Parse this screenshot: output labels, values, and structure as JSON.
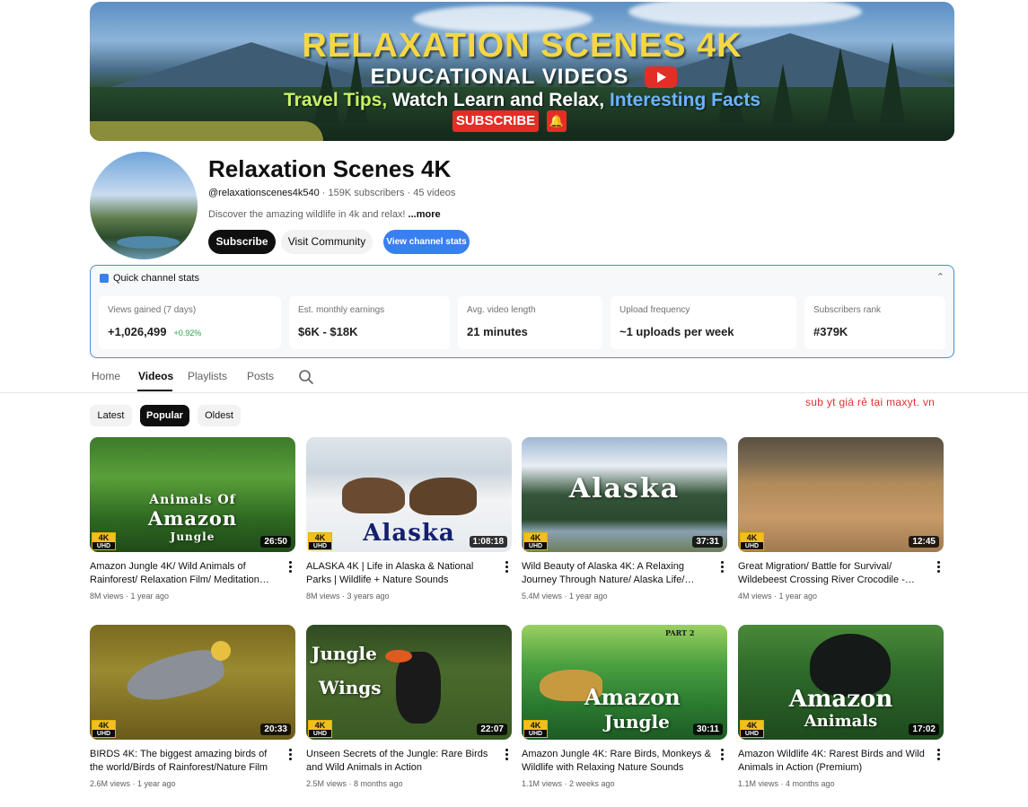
{
  "banner": {
    "title": "RELAXATION SCENES 4K",
    "subtitle": "EDUCATIONAL VIDEOS",
    "tagline_1": "Travel Tips, ",
    "tagline_2": "Watch Learn and Relax, ",
    "tagline_3": "Interesting Facts",
    "subscribe_label": "SUBSCRIBE"
  },
  "channel": {
    "name": "Relaxation Scenes 4K",
    "handle": "@relaxationscenes4k540",
    "stats_text": " · 159K subscribers · 45 videos",
    "description": "Discover the amazing wildlife in 4k and relax! ",
    "more_label": "...more"
  },
  "actions": {
    "subscribe": "Subscribe",
    "community": "Visit Community",
    "stats": "View channel stats"
  },
  "quick_stats": {
    "title": "Quick channel stats",
    "items": [
      {
        "label": "Views gained (7 days)",
        "value": "+1,026,499",
        "change": "+0.92%"
      },
      {
        "label": "Est. monthly earnings",
        "value": "$6K - $18K"
      },
      {
        "label": "Avg. video length",
        "value": "21 minutes"
      },
      {
        "label": "Upload frequency",
        "value": "~1 uploads per week"
      },
      {
        "label": "Subscribers rank",
        "value": "#379K"
      }
    ]
  },
  "tabs": [
    "Home",
    "Videos",
    "Playlists",
    "Posts"
  ],
  "active_tab": "Videos",
  "promo_text": "sub yt giá rẻ tại maxyt. vn",
  "filters": [
    "Latest",
    "Popular",
    "Oldest"
  ],
  "active_filter": "Popular",
  "badge": {
    "top": "4K",
    "bottom": "UHD"
  },
  "videos": [
    {
      "title": "Amazon Jungle 4K/ Wild Animals of Rainforest/ Relaxation Film/ Meditation…",
      "views": "8M views",
      "age": "1 year ago",
      "duration": "26:50",
      "thumb_text_1": "Animals Of",
      "thumb_text_2": "Amazon",
      "thumb_text_3": "Jungle"
    },
    {
      "title": "ALASKA 4K | Life in Alaska & National Parks | Wildlife + Nature Sounds",
      "views": "8M views",
      "age": "3 years ago",
      "duration": "1:08:18",
      "thumb_text_1": "Alaska"
    },
    {
      "title": "Wild Beauty of Alaska 4K: A Relaxing Journey Through Nature/ Alaska Life/…",
      "views": "5.4M views",
      "age": "1 year ago",
      "duration": "37:31",
      "thumb_text_1": "Alaska"
    },
    {
      "title": "Great Migration/ Battle for Survival/ Wildebeest Crossing River Crocodile -…",
      "views": "4M views",
      "age": "1 year ago",
      "duration": "12:45"
    },
    {
      "title": "BIRDS 4K: The biggest amazing birds of the world/Birds of Rainforest/Nature Film &…",
      "views": "2.6M views",
      "age": "1 year ago",
      "duration": "20:33"
    },
    {
      "title": "Unseen Secrets of the Jungle: Rare Birds and Wild Animals in Action",
      "views": "2.5M views",
      "age": "8 months ago",
      "duration": "22:07",
      "thumb_text_1": "Jungle",
      "thumb_text_2": "Wings"
    },
    {
      "title": "Amazon Jungle 4K: Rare Birds, Monkeys & Wildlife with Relaxing Nature Sounds",
      "views": "1.1M views",
      "age": "2 weeks ago",
      "duration": "30:11",
      "thumb_text_1": "Amazon",
      "thumb_text_2": "Jungle",
      "thumb_text_3": "PART 2"
    },
    {
      "title": "Amazon Wildlife 4K: Rarest Birds and Wild Animals in Action (Premium)",
      "views": "1.1M views",
      "age": "4 months ago",
      "duration": "17:02",
      "thumb_text_1": "Amazon",
      "thumb_text_2": "Animals"
    }
  ],
  "colors": {
    "accent_blue": "#3a7ff0",
    "promo_red": "#e03030",
    "positive_green": "#2aa34a",
    "youtube_red": "#e52d27"
  }
}
